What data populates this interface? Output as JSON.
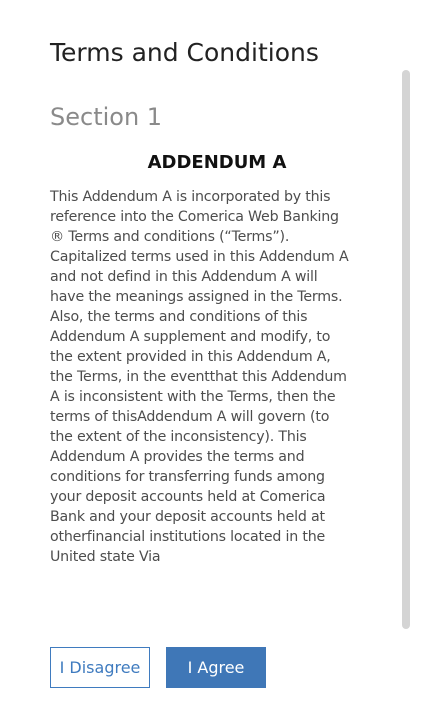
{
  "page": {
    "title": "Terms and Conditions"
  },
  "section": {
    "title": "Section 1"
  },
  "addendum": {
    "heading": "ADDENDUM A",
    "body": "This Addendum A is incorporated by this reference into the Comerica Web Banking ® Terms and conditions (“Terms”). Capitalized terms used in this Addendum A and not defind in this Addendum A will have the meanings assigned in the Terms. Also, the terms and conditions of this Addendum A supplement and modify, to the extent provided in this Addendum A, the Terms, in the eventthat this Addendum A is inconsistent with the Terms, then the terms of thisAddendum A will govern (to the extent of the inconsistency). This Addendum A provides the terms and conditions for transferring funds among your deposit accounts held at Comerica Bank and your deposit accounts held at otherfinancial institutions located in the United state Via"
  },
  "actions": {
    "disagree_label": "I Disagree",
    "agree_label": "I Agree"
  },
  "colors": {
    "accent": "#3f77b7",
    "scrollbar": "#d4d4d4",
    "section_title": "#8a8a8a"
  }
}
